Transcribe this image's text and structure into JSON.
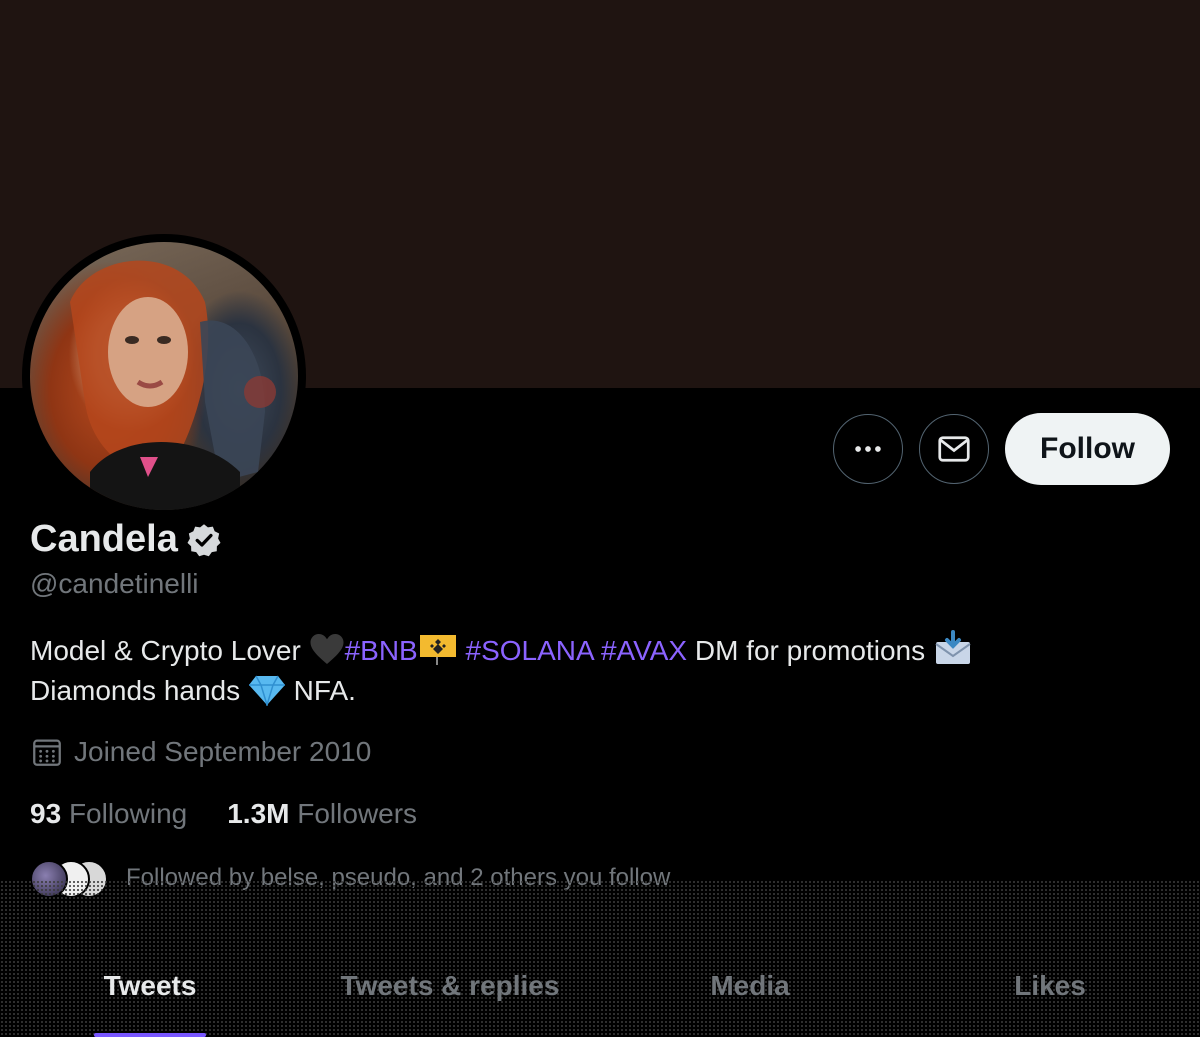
{
  "profile": {
    "display_name": "Candela",
    "handle": "@candetinelli",
    "bio": {
      "line1_start": "Model & Crypto Lover ",
      "hashtag_bnb": "#BNB",
      "hashtag_solana": "#SOLANA",
      "hashtag_avax": "#AVAX",
      "line1_end": " DM for promotions ",
      "line2_start": "Diamonds hands ",
      "line2_end": " NFA."
    },
    "joined": "Joined September 2010",
    "following_count": "93",
    "following_label": "Following",
    "followers_count": "1.3M",
    "followers_label": "Followers",
    "followed_by": "Followed by belse, pseudo, and 2 others you follow"
  },
  "actions": {
    "more_icon": "more-icon",
    "message_icon": "envelope-icon",
    "follow_label": "Follow"
  },
  "tabs": [
    {
      "label": "Tweets",
      "active": true
    },
    {
      "label": "Tweets & replies",
      "active": false
    },
    {
      "label": "Media",
      "active": false
    },
    {
      "label": "Likes",
      "active": false
    }
  ],
  "colors": {
    "banner": "#1f1411",
    "hashtag": "#8b63ff",
    "accent": "#7856ff",
    "muted": "#71767b",
    "text": "#e7e9ea"
  }
}
